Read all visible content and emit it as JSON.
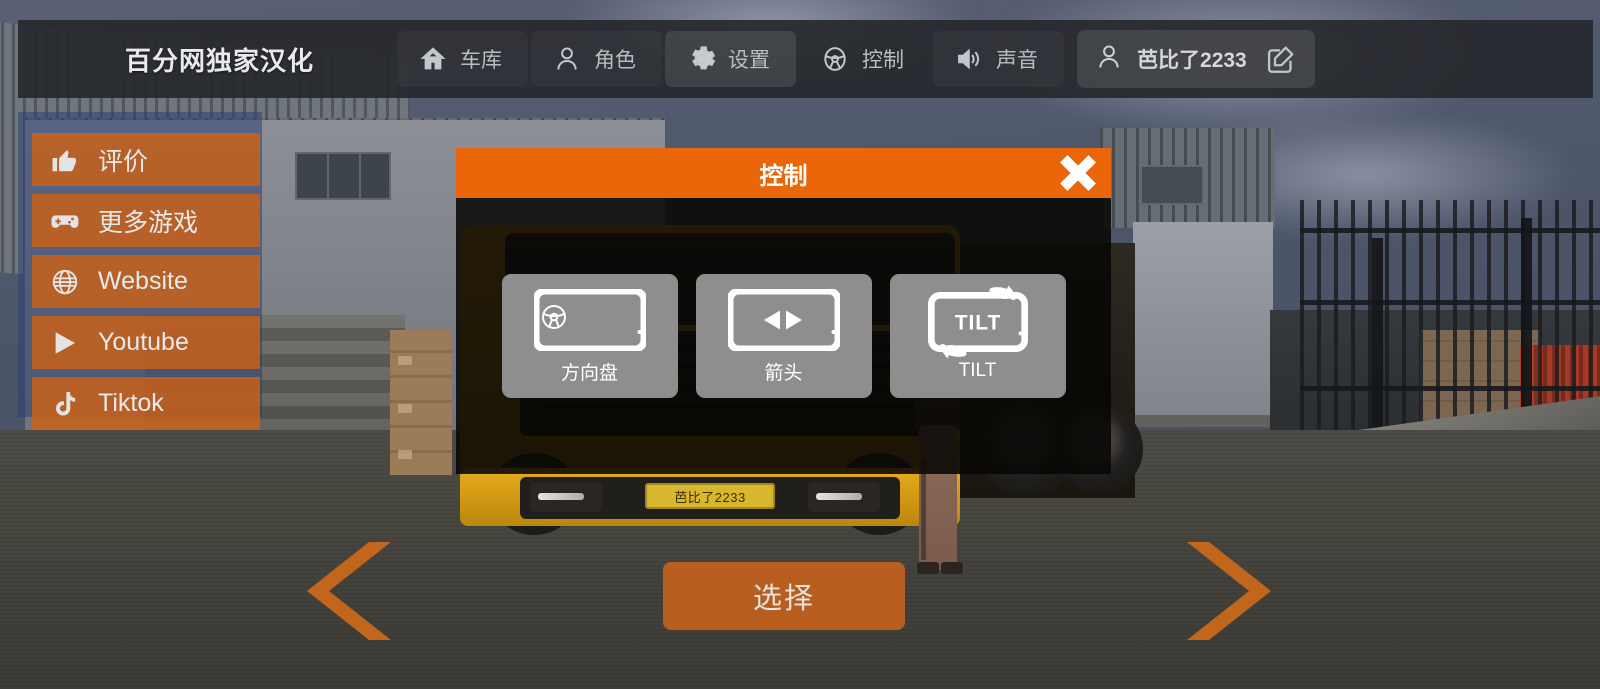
{
  "topbar": {
    "brand": "百分网独家汉化",
    "nav": [
      {
        "label": "车库",
        "icon": "home-icon",
        "active": false
      },
      {
        "label": "角色",
        "icon": "person-icon",
        "active": false
      },
      {
        "label": "设置",
        "icon": "gear-icon",
        "active": true
      },
      {
        "label": "控制",
        "icon": "steering-wheel-icon",
        "active": false
      },
      {
        "label": "声音",
        "icon": "speaker-icon",
        "active": false
      }
    ],
    "user": {
      "name": "芭比了2233",
      "avatar_icon": "person-icon",
      "edit_icon": "edit-pencil-icon"
    }
  },
  "sidemenu": {
    "items": [
      {
        "label": "评价",
        "icon": "thumbs-up-icon"
      },
      {
        "label": "更多游戏",
        "icon": "gamepad-icon"
      },
      {
        "label": "Website",
        "icon": "globe-icon"
      },
      {
        "label": "Youtube",
        "icon": "play-triangle-icon"
      },
      {
        "label": "Tiktok",
        "icon": "tiktok-note-icon"
      }
    ]
  },
  "modal": {
    "title": "控制",
    "close_icon": "close-x-icon",
    "options": [
      {
        "label": "方向盘",
        "icon": "phone-steering-wheel-icon",
        "inner_text": ""
      },
      {
        "label": "箭头",
        "icon": "phone-arrows-icon",
        "inner_text": ""
      },
      {
        "label": "TILT",
        "icon": "phone-tilt-icon",
        "inner_text": "TILT"
      }
    ]
  },
  "bottom": {
    "prev_icon": "chevron-left-icon",
    "next_icon": "chevron-right-icon",
    "select_label": "选择"
  },
  "scene": {
    "license_plate": "芭比了2233"
  },
  "colors": {
    "orange": "#eb6608",
    "menu_orange": "#cd6216",
    "panel_blue": "#2e4072",
    "topbar": "#26282c",
    "card_gray": "#8e8e8e"
  }
}
